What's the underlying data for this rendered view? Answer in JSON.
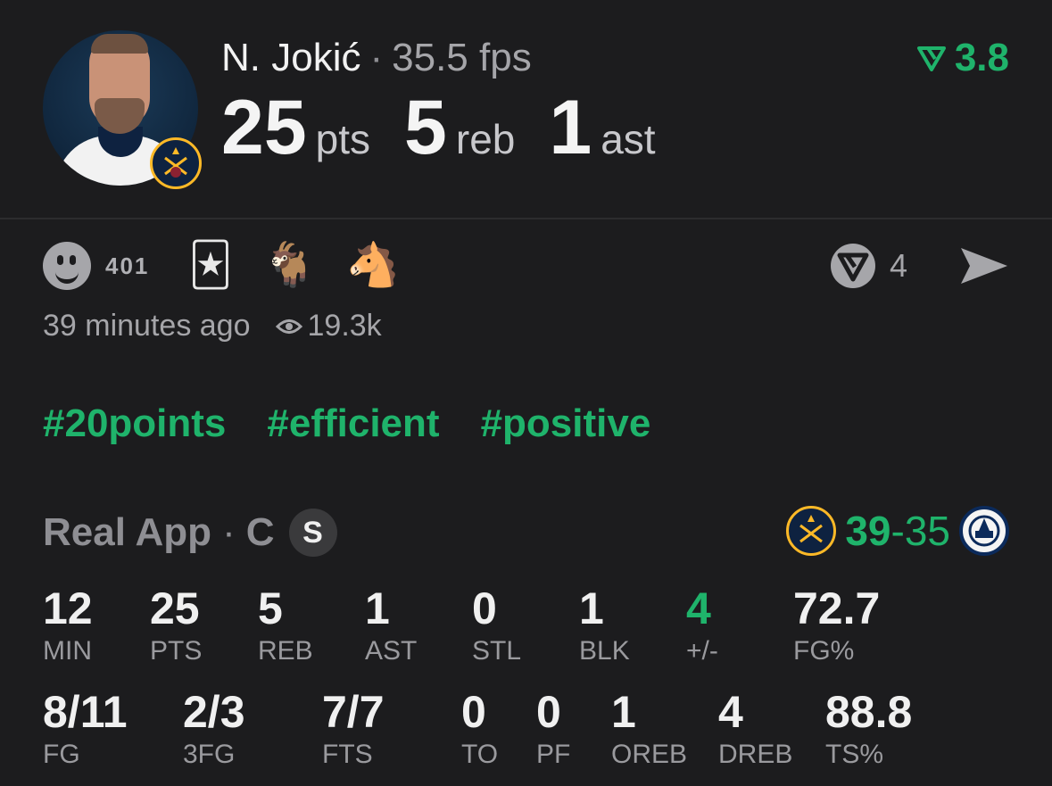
{
  "header": {
    "player_name": "N. Jokić",
    "fps": "35.5 fps",
    "rating": "3.8",
    "points": "25",
    "points_unit": "pts",
    "rebounds": "5",
    "rebounds_unit": "reb",
    "assists": "1",
    "assists_unit": "ast"
  },
  "reactions": {
    "count": "401",
    "emojis": [
      "🃏",
      "🐐",
      "🐴"
    ],
    "vote_count": "4"
  },
  "meta": {
    "time_ago": "39 minutes ago",
    "views": "19.3k"
  },
  "tags": [
    "#20points",
    "#efficient",
    "#positive"
  ],
  "game": {
    "source": "Real App",
    "position": "C",
    "badge": "S",
    "home_score": "39",
    "dash": "-",
    "away_score": "35"
  },
  "stats_row1": [
    {
      "value": "12",
      "label": "MIN"
    },
    {
      "value": "25",
      "label": "PTS"
    },
    {
      "value": "5",
      "label": "REB"
    },
    {
      "value": "1",
      "label": "AST"
    },
    {
      "value": "0",
      "label": "STL"
    },
    {
      "value": "1",
      "label": "BLK"
    },
    {
      "value": "4",
      "label": "+/-"
    },
    {
      "value": "72.7",
      "label": "FG%"
    }
  ],
  "stats_row2": [
    {
      "value": "8/11",
      "label": "FG"
    },
    {
      "value": "2/3",
      "label": "3FG"
    },
    {
      "value": "7/7",
      "label": "FTS"
    },
    {
      "value": "0",
      "label": "TO"
    },
    {
      "value": "0",
      "label": "PF"
    },
    {
      "value": "1",
      "label": "OREB"
    },
    {
      "value": "4",
      "label": "DREB"
    },
    {
      "value": "88.8",
      "label": "TS%"
    }
  ],
  "colors": {
    "accent_green": "#1fb36b",
    "background": "#1c1c1e",
    "team_gold": "#fdb927",
    "team_navy": "#0e2240"
  }
}
